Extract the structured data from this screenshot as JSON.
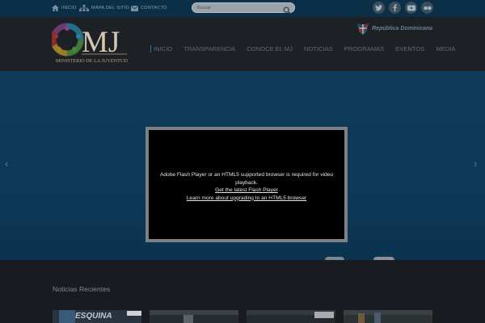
{
  "topbar": {
    "links": [
      {
        "label": "INICIO",
        "icon": "home-icon"
      },
      {
        "label": "MAPA DEL SITIO",
        "icon": "sitemap-icon"
      },
      {
        "label": "CONTACTO",
        "icon": "mail-icon"
      }
    ],
    "search": {
      "placeholder": "Buscar",
      "icon": "search-icon"
    },
    "social": [
      "twitter-icon",
      "facebook-icon",
      "youtube-icon",
      "flickr-icon"
    ]
  },
  "header": {
    "logo_mark": "MJ",
    "logo_text": "MINISTERIO DE LA JUVENTUD",
    "country": "República Dominicana",
    "nav": [
      "INICIO",
      "TRANSPARENCIA",
      "CONOCE EL MJ",
      "NOTICIAS",
      "PROGRAMAS",
      "EVENTOS",
      "MEDIA"
    ]
  },
  "banner": {
    "prev_icon": "chevron-left-icon",
    "next_icon": "chevron-right-icon"
  },
  "modal": {
    "message": "Adobe Flash Player or an HTML5 supported browser is required for video playback.",
    "link_flash": "Get the latest Flash Player",
    "link_html5": "Learn more about upgrading to an HTML5 browser"
  },
  "news": {
    "title": "Noticias Recientes",
    "thumbs": [
      {
        "caption": "ESQUINA"
      },
      {
        "caption": ""
      },
      {
        "caption": ""
      },
      {
        "caption": ""
      }
    ]
  },
  "colors": {
    "topbar": "#0a2f47",
    "header": "#1d2126",
    "banner": "#0d3852",
    "modal_border": "#7d8186",
    "nav_active": "#2a6fa8"
  }
}
